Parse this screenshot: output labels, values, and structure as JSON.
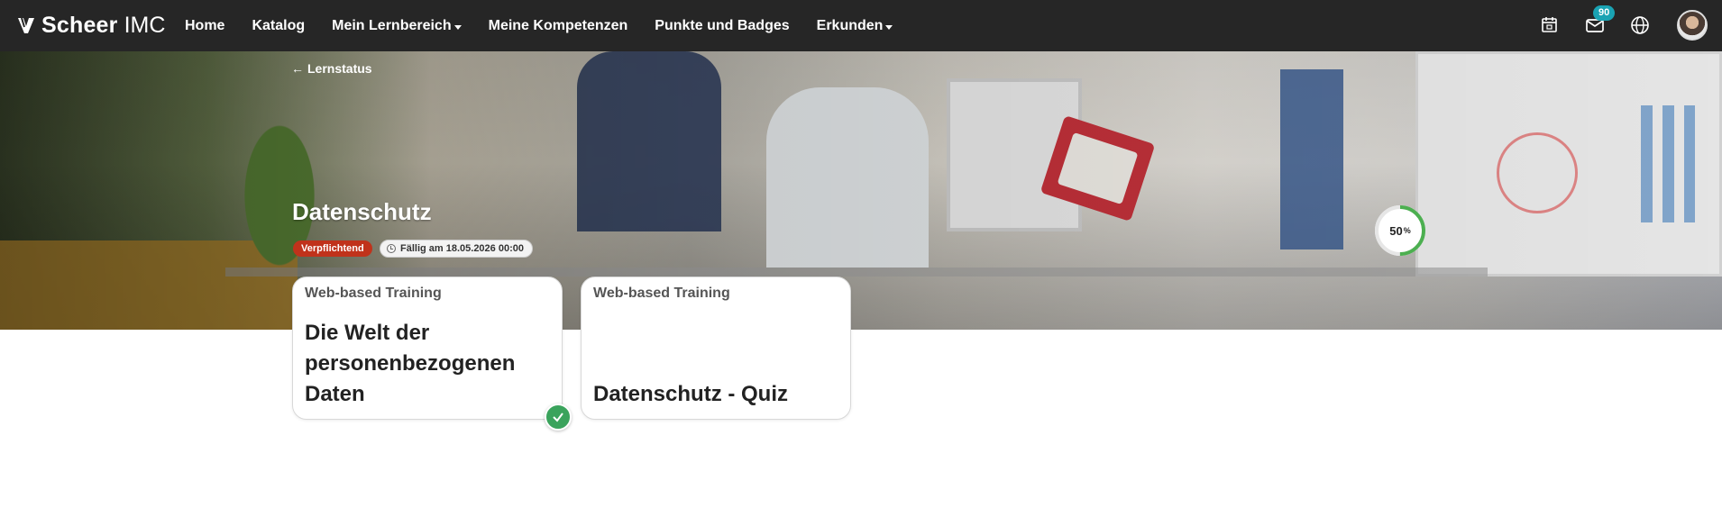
{
  "brand": {
    "name_bold": "Scheer",
    "name_light": "IMC"
  },
  "nav": {
    "items": [
      {
        "label": "Home",
        "dropdown": false
      },
      {
        "label": "Katalog",
        "dropdown": false
      },
      {
        "label": "Mein Lernbereich",
        "dropdown": true
      },
      {
        "label": "Meine Kompetenzen",
        "dropdown": false
      },
      {
        "label": "Punkte und Badges",
        "dropdown": false
      },
      {
        "label": "Erkunden",
        "dropdown": true
      }
    ]
  },
  "header_icons": {
    "calendar": "calendar-icon",
    "messages": "mail-icon",
    "messages_count": "90",
    "language": "globe-icon",
    "profile": "avatar"
  },
  "hero": {
    "back_label": "Lernstatus",
    "back_icon": "arrow-left-icon",
    "title": "Datenschutz",
    "required_tag": "Verpflichtend",
    "due_tag": "Fällig am 18.05.2026 00:00",
    "progress_value": "50",
    "progress_unit": "%",
    "progress_fraction": 0.5,
    "colors": {
      "required": "#c0321b",
      "progress": "#4caf50",
      "badge": "#1aa3b3",
      "check": "#3aa35c"
    }
  },
  "cards": [
    {
      "type": "Web-based Training",
      "title": "Die Welt der personenbezogenen Daten",
      "completed": true
    },
    {
      "type": "Web-based Training",
      "title": "Datenschutz - Quiz",
      "completed": false
    }
  ]
}
